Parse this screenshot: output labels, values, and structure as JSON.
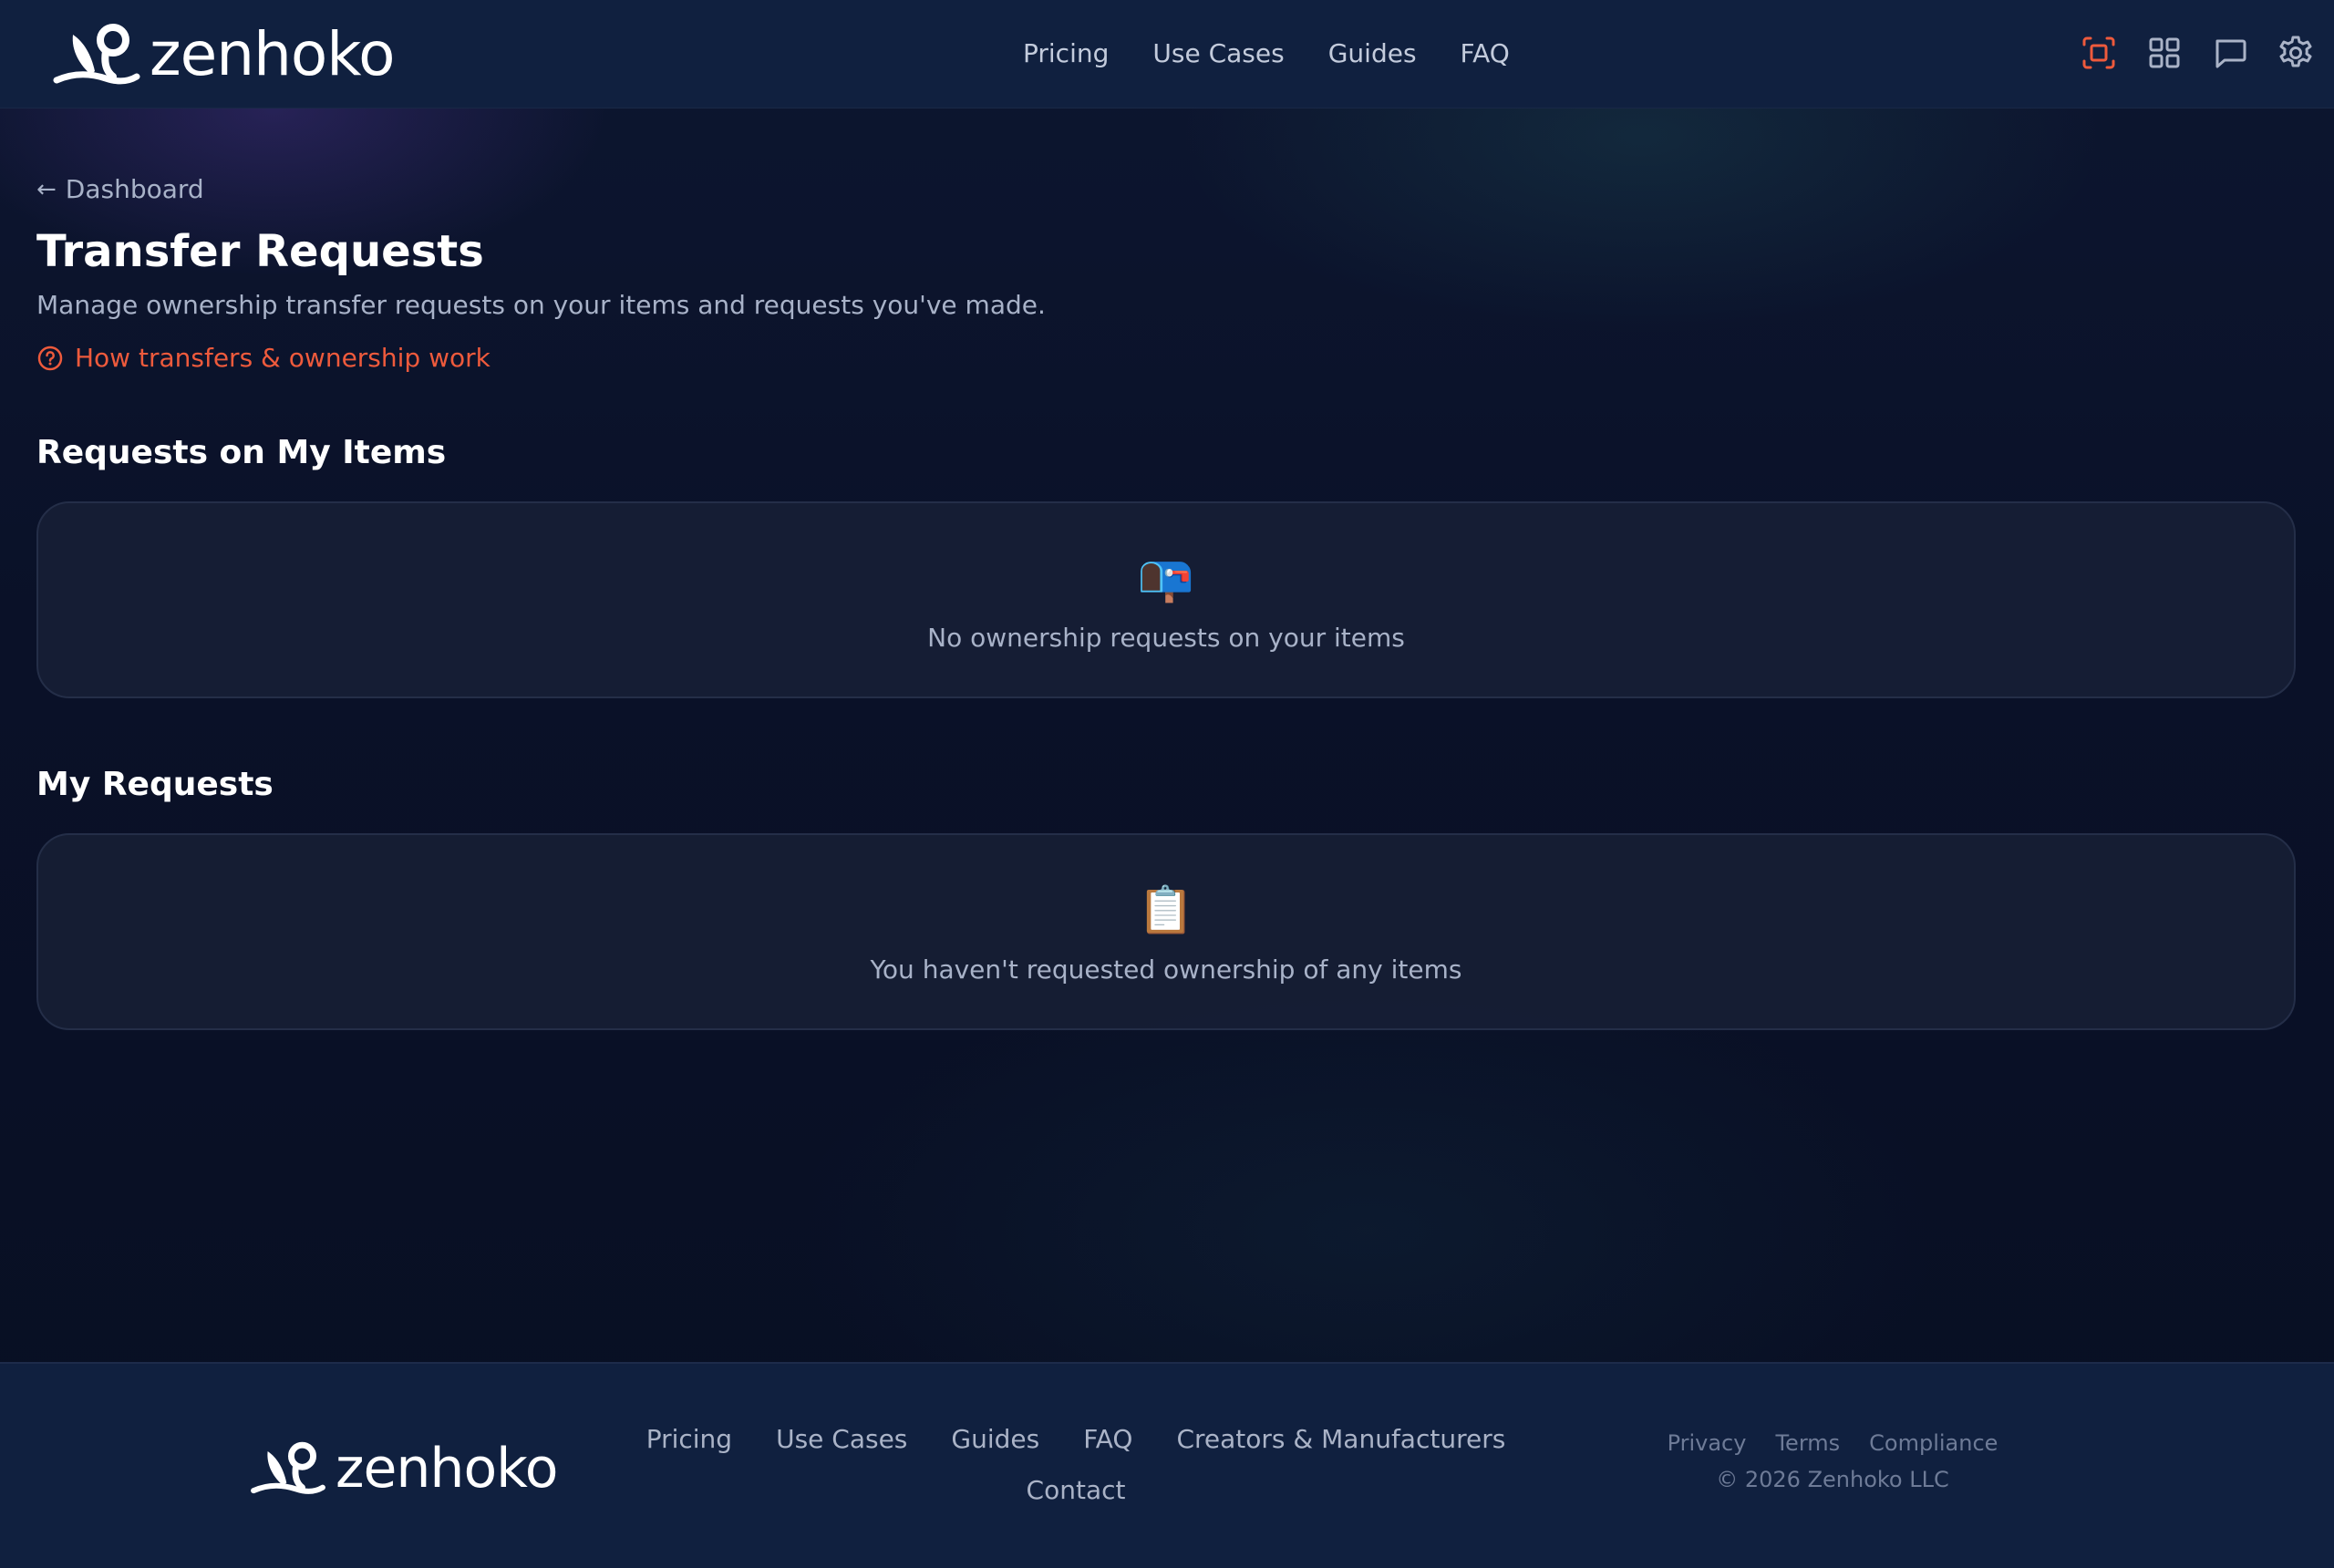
{
  "brand": {
    "name": "zenhoko"
  },
  "nav": {
    "items": [
      "Pricing",
      "Use Cases",
      "Guides",
      "FAQ"
    ]
  },
  "header_icons": [
    "scan-icon",
    "grid-icon",
    "chat-icon",
    "gear-icon"
  ],
  "colors": {
    "accent": "#ee5a3c",
    "header_bg": "#10203f",
    "page_bg": "#0a1128",
    "panel_bg": "#182036"
  },
  "page": {
    "back_label": "Dashboard",
    "title": "Transfer Requests",
    "subtitle": "Manage ownership transfer requests on your items and requests you've made.",
    "help_link": "How transfers & ownership work"
  },
  "sections": [
    {
      "title": "Requests on My Items",
      "empty_icon": "📭",
      "empty_message": "No ownership requests on your items"
    },
    {
      "title": "My Requests",
      "empty_icon": "📋",
      "empty_message": "You haven't requested ownership of any items"
    }
  ],
  "footer": {
    "links": [
      "Pricing",
      "Use Cases",
      "Guides",
      "FAQ",
      "Creators & Manufacturers",
      "Contact"
    ],
    "legal_links": [
      "Privacy",
      "Terms",
      "Compliance"
    ],
    "copyright": "© 2026 Zenhoko LLC"
  }
}
